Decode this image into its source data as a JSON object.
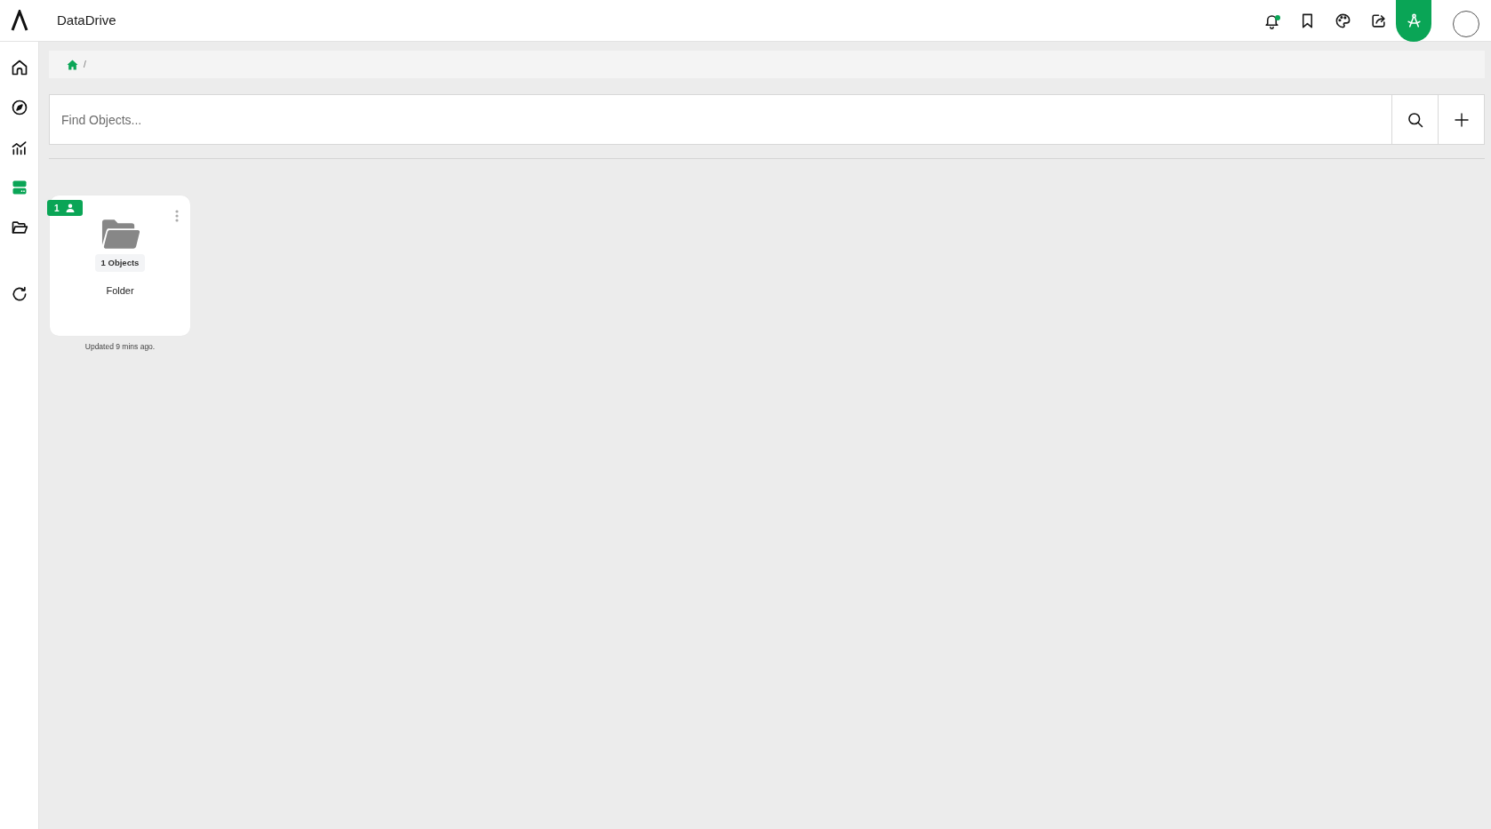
{
  "app": {
    "title": "DataDrive"
  },
  "header_actions": [
    {
      "kind": "bell",
      "dot": true,
      "selected": false
    },
    {
      "kind": "bookmark",
      "dot": false,
      "selected": false
    },
    {
      "kind": "palette",
      "dot": false,
      "selected": false
    },
    {
      "kind": "share",
      "dot": false,
      "selected": false
    },
    {
      "kind": "drafting",
      "dot": false,
      "selected": true
    }
  ],
  "sidebar": {
    "groups": [
      {
        "items": [
          {
            "kind": "home",
            "selected": false
          },
          {
            "kind": "explore",
            "selected": false
          },
          {
            "kind": "analytics",
            "selected": false
          },
          {
            "kind": "storage",
            "selected": true
          },
          {
            "kind": "folder",
            "selected": false
          }
        ]
      },
      {
        "items": [
          {
            "kind": "refresh",
            "selected": false
          }
        ]
      }
    ]
  },
  "breadcrumb": {
    "items": [
      {
        "kind": "home"
      }
    ],
    "separator": "/"
  },
  "search": {
    "placeholder": "Find Objects..."
  },
  "objects": [
    {
      "kind": "folder",
      "name": "Folder",
      "count": "1 Objects",
      "shared": "1",
      "updated": "Updated 9 mins ago."
    }
  ]
}
